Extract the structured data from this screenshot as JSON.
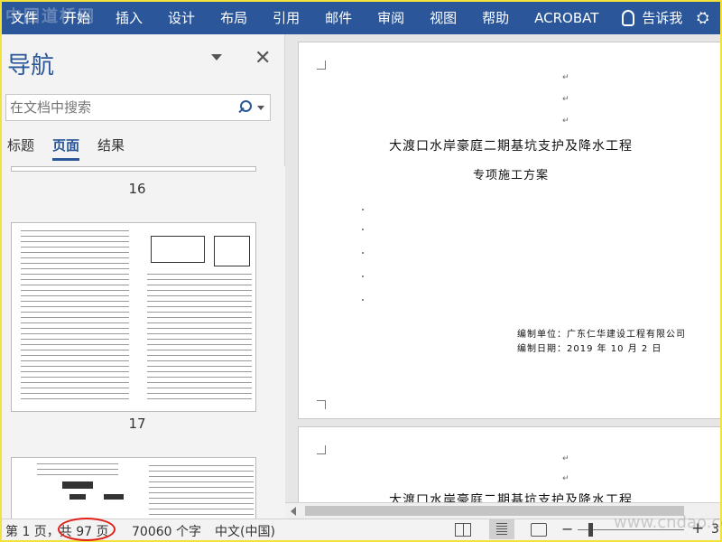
{
  "ribbon": {
    "tabs": [
      "文件",
      "开始",
      "插入",
      "设计",
      "布局",
      "引用",
      "邮件",
      "审阅",
      "视图",
      "帮助",
      "ACROBAT"
    ],
    "tell_me": "告诉我"
  },
  "watermark": {
    "top_left": "中国道桥网",
    "bottom_right": "www.cndao.com"
  },
  "nav": {
    "title": "导航",
    "search_placeholder": "在文档中搜索",
    "tabs": [
      "标题",
      "页面",
      "结果"
    ],
    "active_tab": "页面",
    "page_numbers": [
      "16",
      "17"
    ]
  },
  "document": {
    "page1": {
      "title": "大渡口水岸豪庭二期基坑支护及降水工程",
      "subtitle": "专项施工方案",
      "compiler": "编制单位：广东仁华建设工程有限公司",
      "date": "编制日期：2019 年 10 月 2 日"
    },
    "page2": {
      "title": "大渡口水岸豪庭二期基坑支护及降水工程"
    }
  },
  "status": {
    "page_info": "第 1 页，共 97 页",
    "word_count": "70060 个字",
    "language": "中文(中国)",
    "zoom_minus": "−",
    "zoom_plus": "+",
    "zoom": "3"
  },
  "colors": {
    "accent": "#2b579a",
    "annotation": "#e0201a"
  }
}
